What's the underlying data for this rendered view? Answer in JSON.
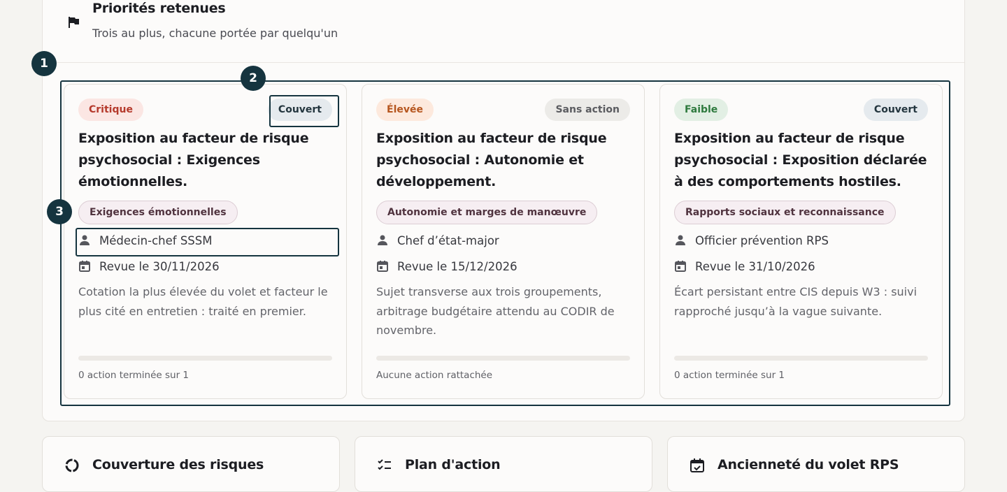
{
  "section": {
    "title": "Priorités retenues",
    "subtitle": "Trois au plus, chacune portée par quelqu'un",
    "flag_icon": "flag-icon"
  },
  "markers": [
    "1",
    "2",
    "3"
  ],
  "cards": [
    {
      "severity": "Critique",
      "status": "Couvert",
      "title": "Exposition au facteur de risque psychosocial : Exigences émotionnelles.",
      "theme": "Exigences émotionnelles",
      "owner": "Médecin-chef SSSM",
      "review": "Revue le 30/11/2026",
      "description": "Cotation la plus élevée du volet et facteur le plus cité en entretien : traité en premier.",
      "progress": 0,
      "footer": "0 action terminée sur 1"
    },
    {
      "severity": "Élevée",
      "status": "Sans action",
      "title": "Exposition au facteur de risque psychosocial : Autonomie et développement.",
      "theme": "Autonomie et marges de manœuvre",
      "owner": "Chef d’état-major",
      "review": "Revue le 15/12/2026",
      "description": "Sujet transverse aux trois groupements, arbitrage budgétaire attendu au CODIR de novembre.",
      "progress": 0,
      "footer": "Aucune action rattachée"
    },
    {
      "severity": "Faible",
      "status": "Couvert",
      "title": "Exposition au facteur de risque psychosocial : Exposition déclarée à des comportements hostiles.",
      "theme": "Rapports sociaux et reconnaissance",
      "owner": "Officier prévention RPS",
      "review": "Revue le 31/10/2026",
      "description": "Écart persistant entre CIS depuis W3 : suivi rapproché jusqu’à la vague suivante.",
      "progress": 0,
      "footer": "0 action terminée sur 1"
    }
  ],
  "bottom_cards": [
    {
      "title": "Couverture des risques",
      "icon": "donut-chart-icon"
    },
    {
      "title": "Plan d'action",
      "icon": "checklist-icon"
    },
    {
      "title": "Ancienneté du volet RPS",
      "icon": "calendar-check-icon"
    }
  ],
  "colors": {
    "accent": "#15343f",
    "critique": "#b53a2c",
    "elevee": "#b6561f",
    "faible": "#2e7a3e"
  }
}
